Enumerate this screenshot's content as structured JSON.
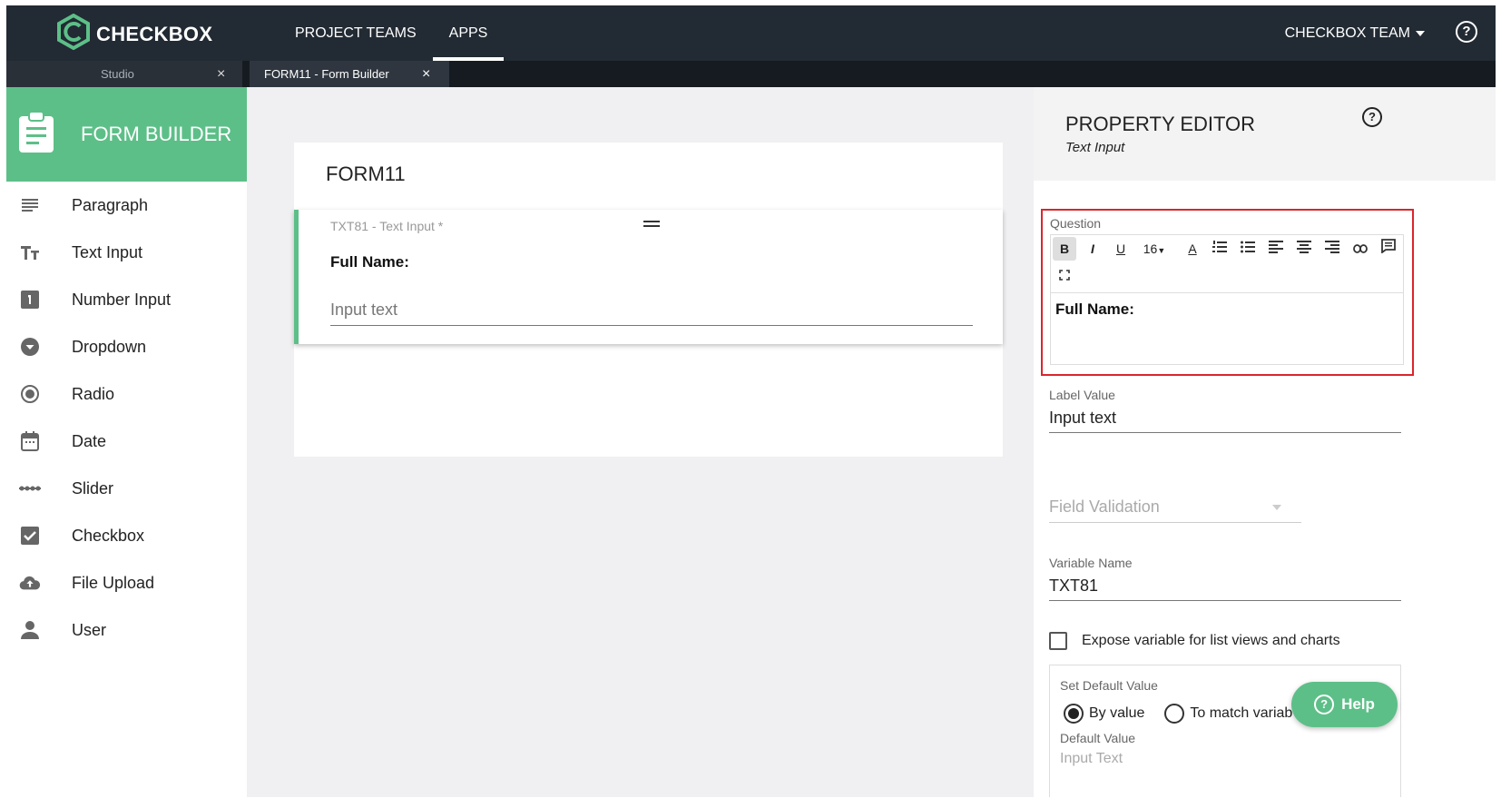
{
  "brand": {
    "logo_text": "CHECKBOX"
  },
  "topnav": {
    "items": [
      {
        "label": "PROJECT TEAMS"
      },
      {
        "label": "APPS"
      }
    ],
    "team": "CHECKBOX TEAM"
  },
  "tabs": [
    {
      "label": "Studio",
      "close": "×"
    },
    {
      "label": "FORM11 - Form Builder",
      "close": "×"
    }
  ],
  "sidebar": {
    "title": "FORM BUILDER",
    "tools": [
      {
        "label": "Paragraph",
        "icon": "paragraph-icon"
      },
      {
        "label": "Text Input",
        "icon": "text-input-icon"
      },
      {
        "label": "Number Input",
        "icon": "number-input-icon"
      },
      {
        "label": "Dropdown",
        "icon": "dropdown-icon"
      },
      {
        "label": "Radio",
        "icon": "radio-icon"
      },
      {
        "label": "Date",
        "icon": "calendar-icon"
      },
      {
        "label": "Slider",
        "icon": "slider-icon"
      },
      {
        "label": "Checkbox",
        "icon": "checkbox-icon"
      },
      {
        "label": "File Upload",
        "icon": "cloud-upload-icon"
      },
      {
        "label": "User",
        "icon": "user-icon"
      }
    ]
  },
  "form": {
    "title": "FORM11",
    "field": {
      "meta": "TXT81 - Text Input *",
      "label": "Full Name:",
      "placeholder": "Input text"
    }
  },
  "property_editor": {
    "title": "PROPERTY EDITOR",
    "subtitle": "Text Input",
    "question_label": "Question",
    "toolbar": {
      "bold": "B",
      "italic": "I",
      "underline": "U",
      "font_size": "16",
      "font_color": "A"
    },
    "question_content": "Full Name:",
    "label_value_label": "Label Value",
    "label_value": "Input text",
    "field_validation_placeholder": "Field Validation",
    "variable_name_label": "Variable Name",
    "variable_name": "TXT81",
    "expose_label": "Expose variable for list views and charts",
    "default_value": {
      "title": "Set Default Value",
      "option_by_value": "By value",
      "option_match": "To match variab",
      "sub_label": "Default Value",
      "input_placeholder": "Input Text"
    }
  },
  "help_button": "Help",
  "colors": {
    "topbar": "#222a33",
    "accent_green": "#5dbf88",
    "highlight_red": "#d9262c"
  }
}
